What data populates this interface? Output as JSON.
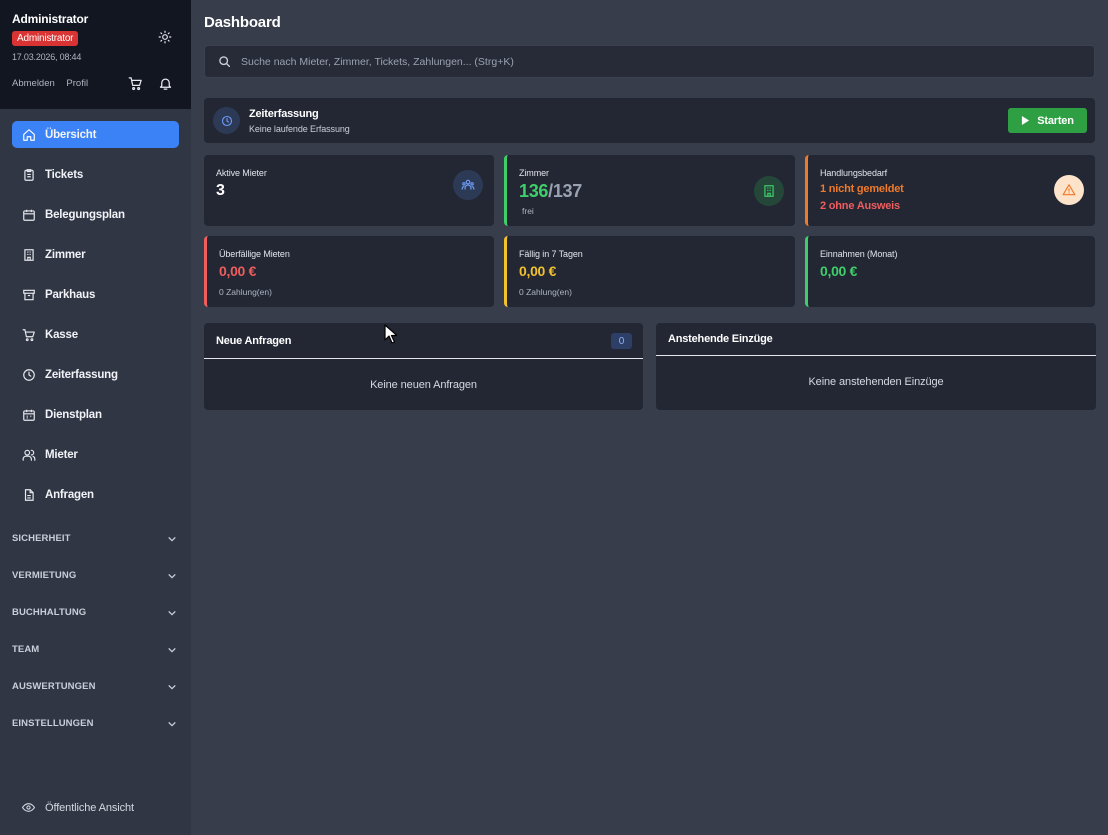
{
  "user": {
    "name": "Administrator",
    "role": "Administrator",
    "datetime": "17.03.2026, 08:44",
    "logout": "Abmelden",
    "profile": "Profil"
  },
  "nav": {
    "items": [
      {
        "label": "Übersicht",
        "icon": "home-icon",
        "active": true
      },
      {
        "label": "Tickets",
        "icon": "clipboard-icon"
      },
      {
        "label": "Belegungsplan",
        "icon": "calendar-icon"
      },
      {
        "label": "Zimmer",
        "icon": "building-icon"
      },
      {
        "label": "Parkhaus",
        "icon": "archive-icon"
      },
      {
        "label": "Kasse",
        "icon": "cart-icon"
      },
      {
        "label": "Zeiterfassung",
        "icon": "clock-icon"
      },
      {
        "label": "Dienstplan",
        "icon": "calendar-grid-icon"
      },
      {
        "label": "Mieter",
        "icon": "users-icon"
      },
      {
        "label": "Anfragen",
        "icon": "document-icon"
      }
    ],
    "groups": [
      "SICHERHEIT",
      "VERMIETUNG",
      "BUCHHALTUNG",
      "TEAM",
      "AUSWERTUNGEN",
      "EINSTELLUNGEN"
    ],
    "public_view": "Öffentliche Ansicht"
  },
  "page": {
    "title": "Dashboard",
    "search_placeholder": "Suche nach Mieter, Zimmer, Tickets, Zahlungen... (Strg+K)"
  },
  "time_tracking": {
    "title": "Zeiterfassung",
    "subtitle": "Keine laufende Erfassung",
    "start_label": "Starten"
  },
  "stats": {
    "active_tenants": {
      "label": "Aktive Mieter",
      "value": "3"
    },
    "rooms": {
      "label": "Zimmer",
      "free": "136",
      "separator": "/",
      "total": "137",
      "sub": "frei"
    },
    "action_needed": {
      "label": "Handlungsbedarf",
      "line1": "1 nicht gemeldet",
      "line2": "2 ohne Ausweis"
    },
    "overdue": {
      "label": "Überfällige Mieten",
      "value": "0,00 €",
      "sub": "0 Zahlung(en)"
    },
    "due7": {
      "label": "Fällig in 7 Tagen",
      "value": "0,00 €",
      "sub": "0 Zahlung(en)"
    },
    "income": {
      "label": "Einnahmen (Monat)",
      "value": "0,00 €"
    }
  },
  "panels": {
    "requests": {
      "title": "Neue Anfragen",
      "count": "0",
      "empty": "Keine neuen Anfragen"
    },
    "moveins": {
      "title": "Anstehende Einzüge",
      "empty": "Keine anstehenden Einzüge"
    }
  },
  "colors": {
    "accent_blue": "#3b82f6",
    "green": "#3fcf6a",
    "orange": "#f07a2a",
    "red": "#ef5d5d",
    "yellow": "#f2c12e"
  }
}
